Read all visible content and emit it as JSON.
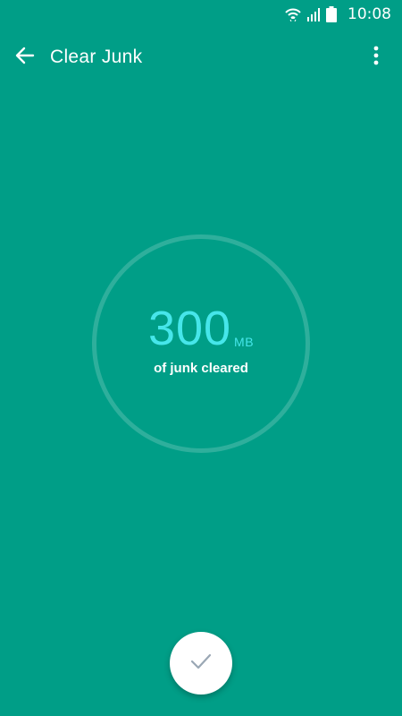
{
  "status_bar": {
    "time": "10:08",
    "icons": [
      "wifi-icon",
      "signal-icon",
      "battery-icon"
    ]
  },
  "toolbar": {
    "back_icon": "arrow-left-icon",
    "title": "Clear Junk",
    "menu_icon": "more-vertical-icon"
  },
  "result": {
    "amount": "300",
    "unit": "MB",
    "caption": "of junk cleared"
  },
  "done_button": {
    "icon": "check-icon"
  },
  "colors": {
    "background": "#009e87",
    "accent": "#46e6ea",
    "button": "#ffffff"
  }
}
